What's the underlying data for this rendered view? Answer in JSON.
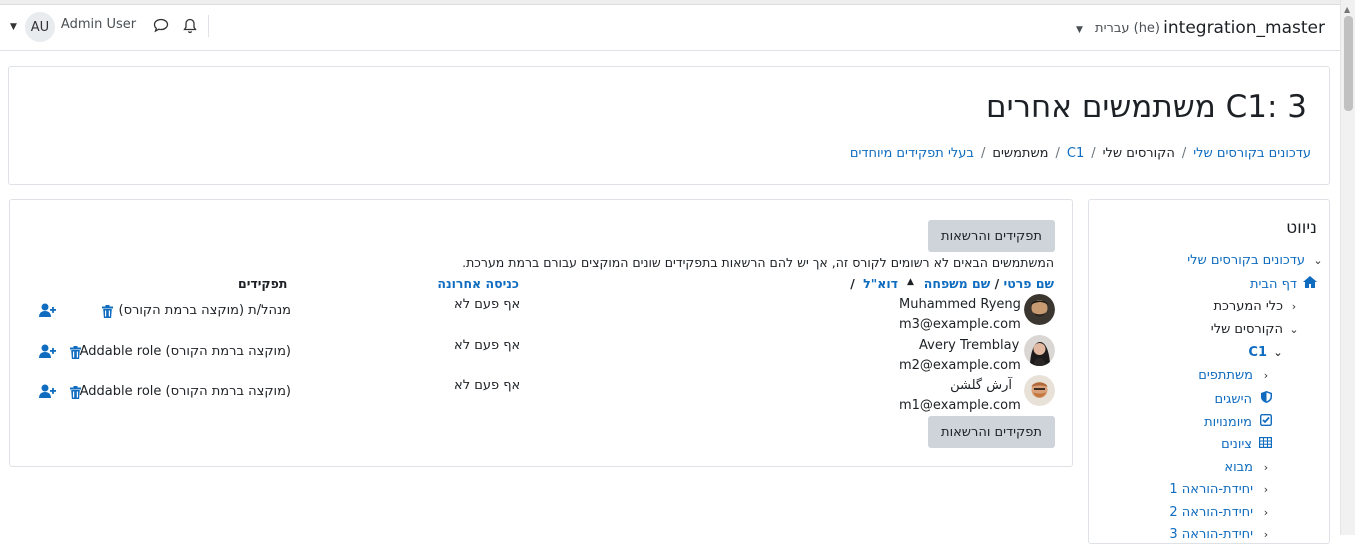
{
  "navbar": {
    "site_name": "integration_master",
    "language": "עברית (he)",
    "user_initials": "AU",
    "user_name": "Admin User"
  },
  "header": {
    "title": "C1: 3 משתמשים אחרים",
    "breadcrumb": [
      "עדכונים בקורסים שלי",
      "הקורסים שלי",
      "C1",
      "משתמשים",
      "בעלי תפקידים מיוחדים"
    ]
  },
  "main": {
    "button_label": "תפקידים והרשאות",
    "notice": "המשתמשים הבאים לא רשומים לקורס זה, אך יש להם הרשאות בתפקידים שונים המוקצים עבורם ברמת מערכת.",
    "headers": {
      "firstname": "שם פרטי",
      "slash": "/",
      "lastname": "שם משפחה",
      "email": "דוא\"ל",
      "lastaccess": "כניסה אחרונה",
      "roles": "תפקידים"
    },
    "rows": [
      {
        "name": "Muhammed Ryeng",
        "email": "m3@example.com",
        "lastaccess": "אף פעם לא",
        "role": "מנהל/ת (מוקצה ברמת הקורס)"
      },
      {
        "name": "Avery Tremblay",
        "email": "m2@example.com",
        "lastaccess": "אף פעם לא",
        "role": "Addable role (מוקצה ברמת הקורס)"
      },
      {
        "name": "آرش گلشن",
        "email": "m1@example.com",
        "lastaccess": "אף פעם לא",
        "role": "Addable role (מוקצה ברמת הקורס)"
      }
    ]
  },
  "nav": {
    "title": "ניווט",
    "items": [
      {
        "label": "עדכונים בקורסים שלי",
        "icon": "chevron-down-icon"
      },
      {
        "label": "דף הבית",
        "icon": "home-icon"
      },
      {
        "label": "כלי המערכת",
        "icon": "chevron-right-icon"
      },
      {
        "label": "הקורסים שלי",
        "icon": "chevron-down-icon"
      },
      {
        "label": "C1",
        "icon": "chevron-down-icon"
      },
      {
        "label": "משתתפים",
        "icon": "chevron-right-icon"
      },
      {
        "label": "הישגים",
        "icon": "shield-icon"
      },
      {
        "label": "מיומנויות",
        "icon": "checkbox-icon"
      },
      {
        "label": "ציונים",
        "icon": "table-icon"
      },
      {
        "label": "מבוא",
        "icon": "chevron-right-icon"
      },
      {
        "label": "יחידת-הוראה 1",
        "icon": "chevron-right-icon"
      },
      {
        "label": "יחידת-הוראה 2",
        "icon": "chevron-right-icon"
      },
      {
        "label": "יחידת-הוראה 3",
        "icon": "chevron-right-icon"
      }
    ]
  },
  "colors": {
    "link": "#0f6cbf",
    "button": "#ced4da",
    "border": "#dee2e6"
  }
}
